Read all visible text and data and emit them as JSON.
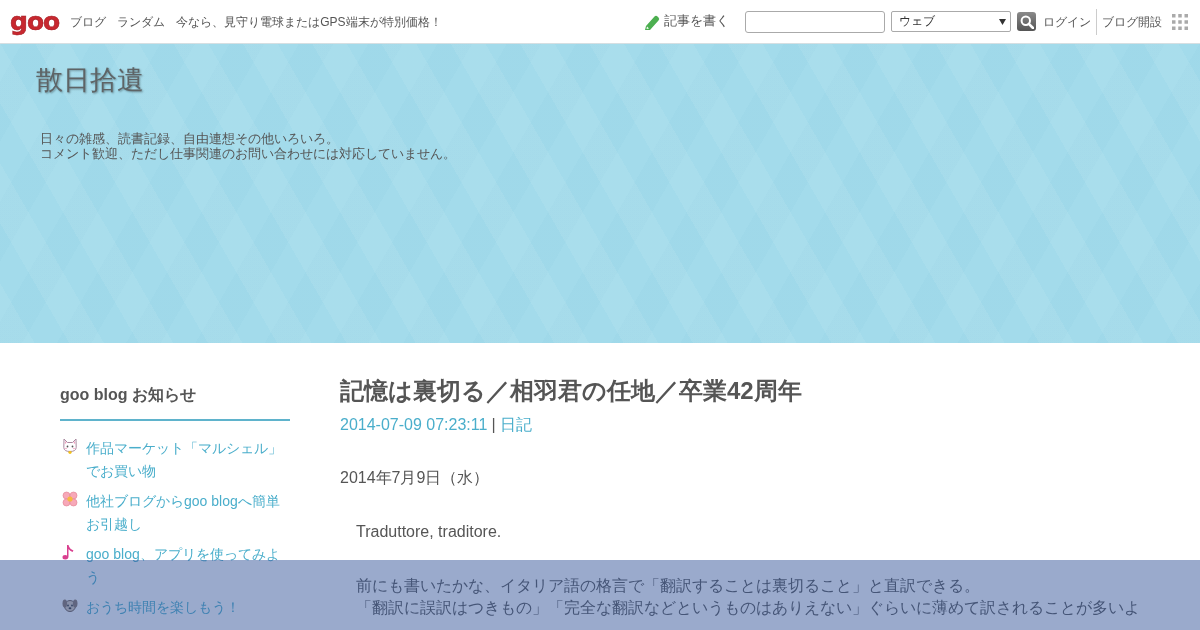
{
  "top_bar": {
    "logo": "goo",
    "links": [
      "ブログ",
      "ランダム",
      "今なら、見守り電球またはGPS端末が特別価格！"
    ],
    "write_link": "記事を書く",
    "search_select": {
      "value": "ウェブ"
    },
    "login": "ログイン",
    "open_blog": "ブログ開設"
  },
  "header": {
    "title": "散日拾遺",
    "description": [
      "日々の雑感、読書記録、自由連想その他いろいろ。",
      "コメント歓迎、ただし仕事関連のお問い合わせには対応していません。"
    ]
  },
  "sidebar": {
    "heading": "goo blog お知らせ",
    "items": [
      {
        "label": "作品マーケット「マルシェル」でお買い物"
      },
      {
        "label": "他社ブログからgoo blogへ簡単お引越し"
      },
      {
        "label": "goo blog、アプリを使ってみよう"
      },
      {
        "label": "おうち時間を楽しもう！"
      }
    ]
  },
  "article": {
    "title": "記憶は裏切る／相羽君の任地／卒業42周年",
    "datetime": "2014-07-09 07:23:11",
    "separator": "|",
    "category": "日記",
    "paragraphs": [
      {
        "kind": "date",
        "lines": [
          "2014年7月9日（水）"
        ]
      },
      {
        "kind": "body",
        "lines": [
          "Traduttore, traditore."
        ]
      },
      {
        "kind": "body",
        "lines": [
          "前にも書いたかな、イタリア語の格言で「翻訳することは裏切ること」と直訳できる。",
          "「翻訳に誤訳はつきもの」「完全な翻訳などというものはありえない」ぐらいに薄めて訳されることが多いよ"
        ]
      }
    ]
  }
}
